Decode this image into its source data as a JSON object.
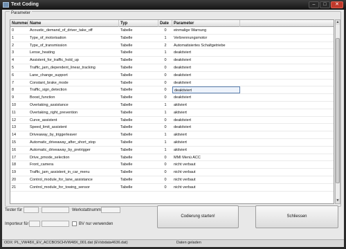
{
  "window": {
    "title": "Text Coding",
    "minimize": "–",
    "maximize": "□",
    "close": "✕"
  },
  "group": {
    "label": "Parameter"
  },
  "table": {
    "headers": [
      "Nummer",
      "Name",
      "Typ",
      "Date",
      "Parameter"
    ],
    "rows": [
      [
        "0",
        "Acoustic_demand_of_driver_take_off",
        "Tabelle",
        "0",
        "einmalige Warnung"
      ],
      [
        "1",
        "Type_of_motorisation",
        "Tabelle",
        "1",
        "Verbrennungsmotor"
      ],
      [
        "2",
        "Type_of_transmission",
        "Tabelle",
        "2",
        "Automatisiertes Schaltgetriebe"
      ],
      [
        "3",
        "Lense_heating",
        "Tabelle",
        "1",
        "deaktiviert"
      ],
      [
        "4",
        "Assistent_for_traffic_hold_up",
        "Tabelle",
        "0",
        "deaktiviert"
      ],
      [
        "5",
        "Traffic_jam_dependent_linear_tracking",
        "Tabelle",
        "0",
        "deaktiviert"
      ],
      [
        "6",
        "Lane_change_support",
        "Tabelle",
        "0",
        "deaktiviert"
      ],
      [
        "7",
        "Constant_brake_mode",
        "Tabelle",
        "0",
        "deaktiviert"
      ],
      [
        "8",
        "Traffic_sign_detection",
        "Tabelle",
        "0",
        "deaktiviert"
      ],
      [
        "9",
        "Boost_function",
        "Tabelle",
        "0",
        "deaktiviert"
      ],
      [
        "10",
        "Overtaking_assistance",
        "Tabelle",
        "1",
        "aktiviert"
      ],
      [
        "11",
        "Overtaking_right_prevention",
        "Tabelle",
        "1",
        "aktiviert"
      ],
      [
        "12",
        "Curve_assistent",
        "Tabelle",
        "0",
        "deaktiviert"
      ],
      [
        "13",
        "Speed_limit_assistent",
        "Tabelle",
        "0",
        "deaktiviert"
      ],
      [
        "14",
        "Driveaway_by_triggerleaver",
        "Tabelle",
        "1",
        "aktiviert"
      ],
      [
        "15",
        "Automatic_driveaway_after_short_stop",
        "Tabelle",
        "1",
        "aktiviert"
      ],
      [
        "16",
        "Automatic_driveaway_by_pretrigger",
        "Tabelle",
        "1",
        "aktiviert"
      ],
      [
        "17",
        "Drive_pmode_selection",
        "Tabelle",
        "0",
        "MMI Menü ACC"
      ],
      [
        "18",
        "Front_camera",
        "Tabelle",
        "0",
        "nicht verbaut"
      ],
      [
        "19",
        "Traffic_jam_assistent_in_car_menu",
        "Tabelle",
        "0",
        "nicht verbaut"
      ],
      [
        "20",
        "Control_module_for_lane_assistance",
        "Tabelle",
        "0",
        "nicht verbaut"
      ],
      [
        "21",
        "Control_module_for_towing_sensor",
        "Tabelle",
        "0",
        "nicht verbaut"
      ]
    ],
    "selected_row": 8
  },
  "form": {
    "tester_label": "Tester für :",
    "importeur_label": "Importeur für :",
    "werkstatt_label": "Werkstattnummer",
    "bv_label": "BV nur verwenden"
  },
  "buttons": {
    "coding": "Codierung starten!",
    "close": "Schliessen"
  },
  "status": {
    "file": "ODX: PL_VW48X_EV_ACCBOSCHVW48X_001.dat (EVsbdata4636.dat)",
    "message": "Daten geladen"
  }
}
